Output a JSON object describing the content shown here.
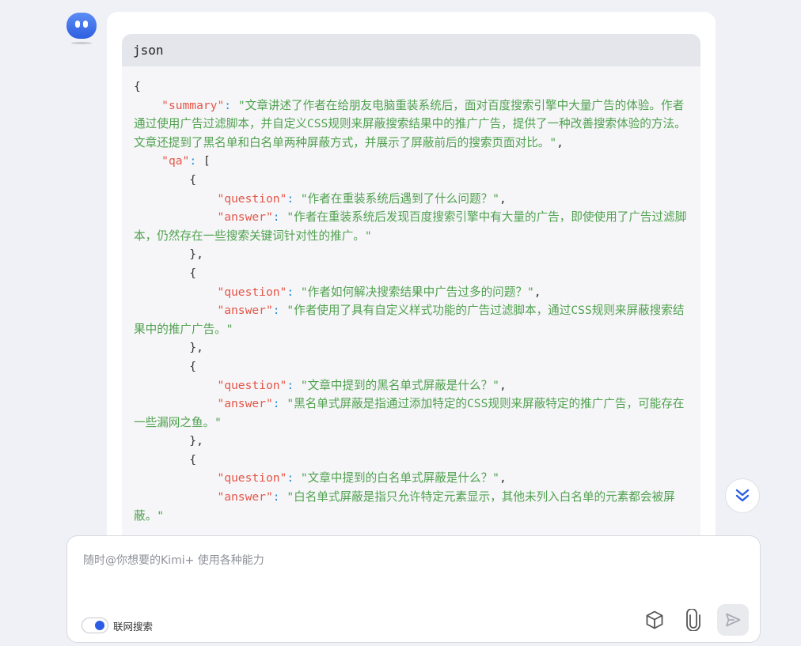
{
  "assistant": {
    "avatar_icon": "kimi-avatar-icon"
  },
  "code_block": {
    "language": "json",
    "lines": [
      [
        {
          "t": "{",
          "c": "p0"
        }
      ],
      [
        {
          "t": "    ",
          "c": "p0"
        },
        {
          "t": "\"summary\"",
          "c": "k"
        },
        {
          "t": ": ",
          "c": "p"
        },
        {
          "t": "\"文章讲述了作者在给朋友电脑重装系统后，面对百度搜索引擎中大量广告的体验。作者通过使用广告过滤脚本，并自定义CSS规则来屏蔽搜索结果中的推广广告，提供了一种改善搜索体验的方法。文章还提到了黑名单和白名单两种屏蔽方式，并展示了屏蔽前后的搜索页面对比。\"",
          "c": "s"
        },
        {
          "t": ",",
          "c": "p0"
        }
      ],
      [
        {
          "t": "    ",
          "c": "p0"
        },
        {
          "t": "\"qa\"",
          "c": "k"
        },
        {
          "t": ": ",
          "c": "p"
        },
        {
          "t": "[",
          "c": "p0"
        }
      ],
      [
        {
          "t": "        {",
          "c": "p0"
        }
      ],
      [
        {
          "t": "            ",
          "c": "p0"
        },
        {
          "t": "\"question\"",
          "c": "k"
        },
        {
          "t": ": ",
          "c": "p"
        },
        {
          "t": "\"作者在重装系统后遇到了什么问题？\"",
          "c": "s"
        },
        {
          "t": ",",
          "c": "p0"
        }
      ],
      [
        {
          "t": "            ",
          "c": "p0"
        },
        {
          "t": "\"answer\"",
          "c": "k"
        },
        {
          "t": ": ",
          "c": "p"
        },
        {
          "t": "\"作者在重装系统后发现百度搜索引擎中有大量的广告，即使使用了广告过滤脚本，仍然存在一些搜索关键词针对性的推广。\"",
          "c": "s"
        }
      ],
      [
        {
          "t": "        },",
          "c": "p0"
        }
      ],
      [
        {
          "t": "        {",
          "c": "p0"
        }
      ],
      [
        {
          "t": "            ",
          "c": "p0"
        },
        {
          "t": "\"question\"",
          "c": "k"
        },
        {
          "t": ": ",
          "c": "p"
        },
        {
          "t": "\"作者如何解决搜索结果中广告过多的问题？\"",
          "c": "s"
        },
        {
          "t": ",",
          "c": "p0"
        }
      ],
      [
        {
          "t": "            ",
          "c": "p0"
        },
        {
          "t": "\"answer\"",
          "c": "k"
        },
        {
          "t": ": ",
          "c": "p"
        },
        {
          "t": "\"作者使用了具有自定义样式功能的广告过滤脚本，通过CSS规则来屏蔽搜索结果中的推广广告。\"",
          "c": "s"
        }
      ],
      [
        {
          "t": "        },",
          "c": "p0"
        }
      ],
      [
        {
          "t": "        {",
          "c": "p0"
        }
      ],
      [
        {
          "t": "            ",
          "c": "p0"
        },
        {
          "t": "\"question\"",
          "c": "k"
        },
        {
          "t": ": ",
          "c": "p"
        },
        {
          "t": "\"文章中提到的黑名单式屏蔽是什么？\"",
          "c": "s"
        },
        {
          "t": ",",
          "c": "p0"
        }
      ],
      [
        {
          "t": "            ",
          "c": "p0"
        },
        {
          "t": "\"answer\"",
          "c": "k"
        },
        {
          "t": ": ",
          "c": "p"
        },
        {
          "t": "\"黑名单式屏蔽是指通过添加特定的CSS规则来屏蔽特定的推广广告，可能存在一些漏网之鱼。\"",
          "c": "s"
        }
      ],
      [
        {
          "t": "        },",
          "c": "p0"
        }
      ],
      [
        {
          "t": "        {",
          "c": "p0"
        }
      ],
      [
        {
          "t": "            ",
          "c": "p0"
        },
        {
          "t": "\"question\"",
          "c": "k"
        },
        {
          "t": ": ",
          "c": "p"
        },
        {
          "t": "\"文章中提到的白名单式屏蔽是什么？\"",
          "c": "s"
        },
        {
          "t": ",",
          "c": "p0"
        }
      ],
      [
        {
          "t": "            ",
          "c": "p0"
        },
        {
          "t": "\"answer\"",
          "c": "k"
        },
        {
          "t": ": ",
          "c": "p"
        },
        {
          "t": "\"白名单式屏蔽是指只允许特定元素显示，其他未列入白名单的元素都会被屏蔽。\"",
          "c": "s"
        }
      ]
    ]
  },
  "scroll_button": {
    "icon": "double-chevron-down-icon"
  },
  "composer": {
    "placeholder": "随时@你想要的Kimi+ 使用各种能力",
    "value": "",
    "web_search_label": "联网搜索",
    "web_search_enabled": true,
    "tools": {
      "cube_icon": "cube-icon",
      "attach_icon": "paperclip-icon",
      "send_icon": "send-icon"
    }
  },
  "colors": {
    "accent": "#2b5ce6",
    "json_key": "#e45649",
    "json_string": "#50a14f",
    "json_punct": "#1e8bd4"
  }
}
